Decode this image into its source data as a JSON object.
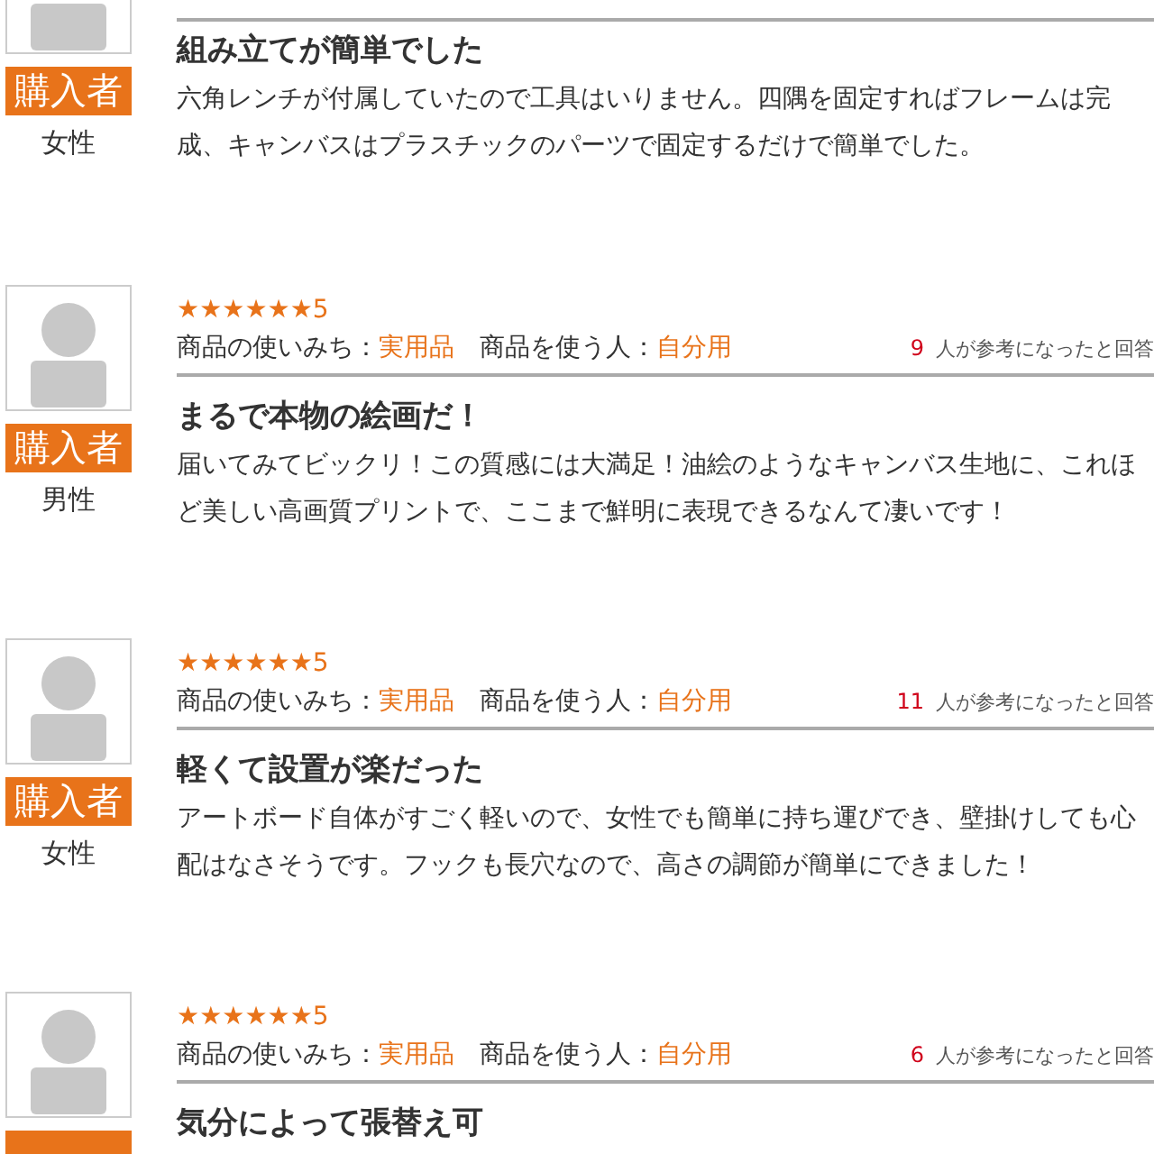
{
  "reviews": [
    {
      "badge": "購入者",
      "gender": "女性",
      "title": "組み立てが簡単でした",
      "body": "六角レンチが付属していたので工具はいりません。四隅を固定すればフレームは完成、キャンバスはプラスチックのパーツで固定するだけで簡単でした。"
    },
    {
      "stars": 6,
      "rating": "5",
      "use_label": "商品の使いみち：",
      "use_value": "実用品",
      "user_label": "商品を使う人：",
      "user_value": "自分用",
      "helpful_count": "9",
      "helpful_text": "人が参考になったと回答",
      "badge": "購入者",
      "gender": "男性",
      "title": "まるで本物の絵画だ！",
      "body": "届いてみてビックリ！この質感には大満足！油絵のようなキャンバス生地に、これほど美しい高画質プリントで、ここまで鮮明に表現できるなんて凄いです！"
    },
    {
      "stars": 6,
      "rating": "5",
      "use_label": "商品の使いみち：",
      "use_value": "実用品",
      "user_label": "商品を使う人：",
      "user_value": "自分用",
      "helpful_count": "11",
      "helpful_text": "人が参考になったと回答",
      "badge": "購入者",
      "gender": "女性",
      "title": "軽くて設置が楽だった",
      "body": "アートボード自体がすごく軽いので、女性でも簡単に持ち運びでき、壁掛けしても心配はなさそうです。フックも長穴なので、高さの調節が簡単にできました！"
    },
    {
      "stars": 6,
      "rating": "5",
      "use_label": "商品の使いみち：",
      "use_value": "実用品",
      "user_label": "商品を使う人：",
      "user_value": "自分用",
      "helpful_count": "6",
      "helpful_text": "人が参考になったと回答",
      "title": "気分によって張替え可"
    }
  ]
}
